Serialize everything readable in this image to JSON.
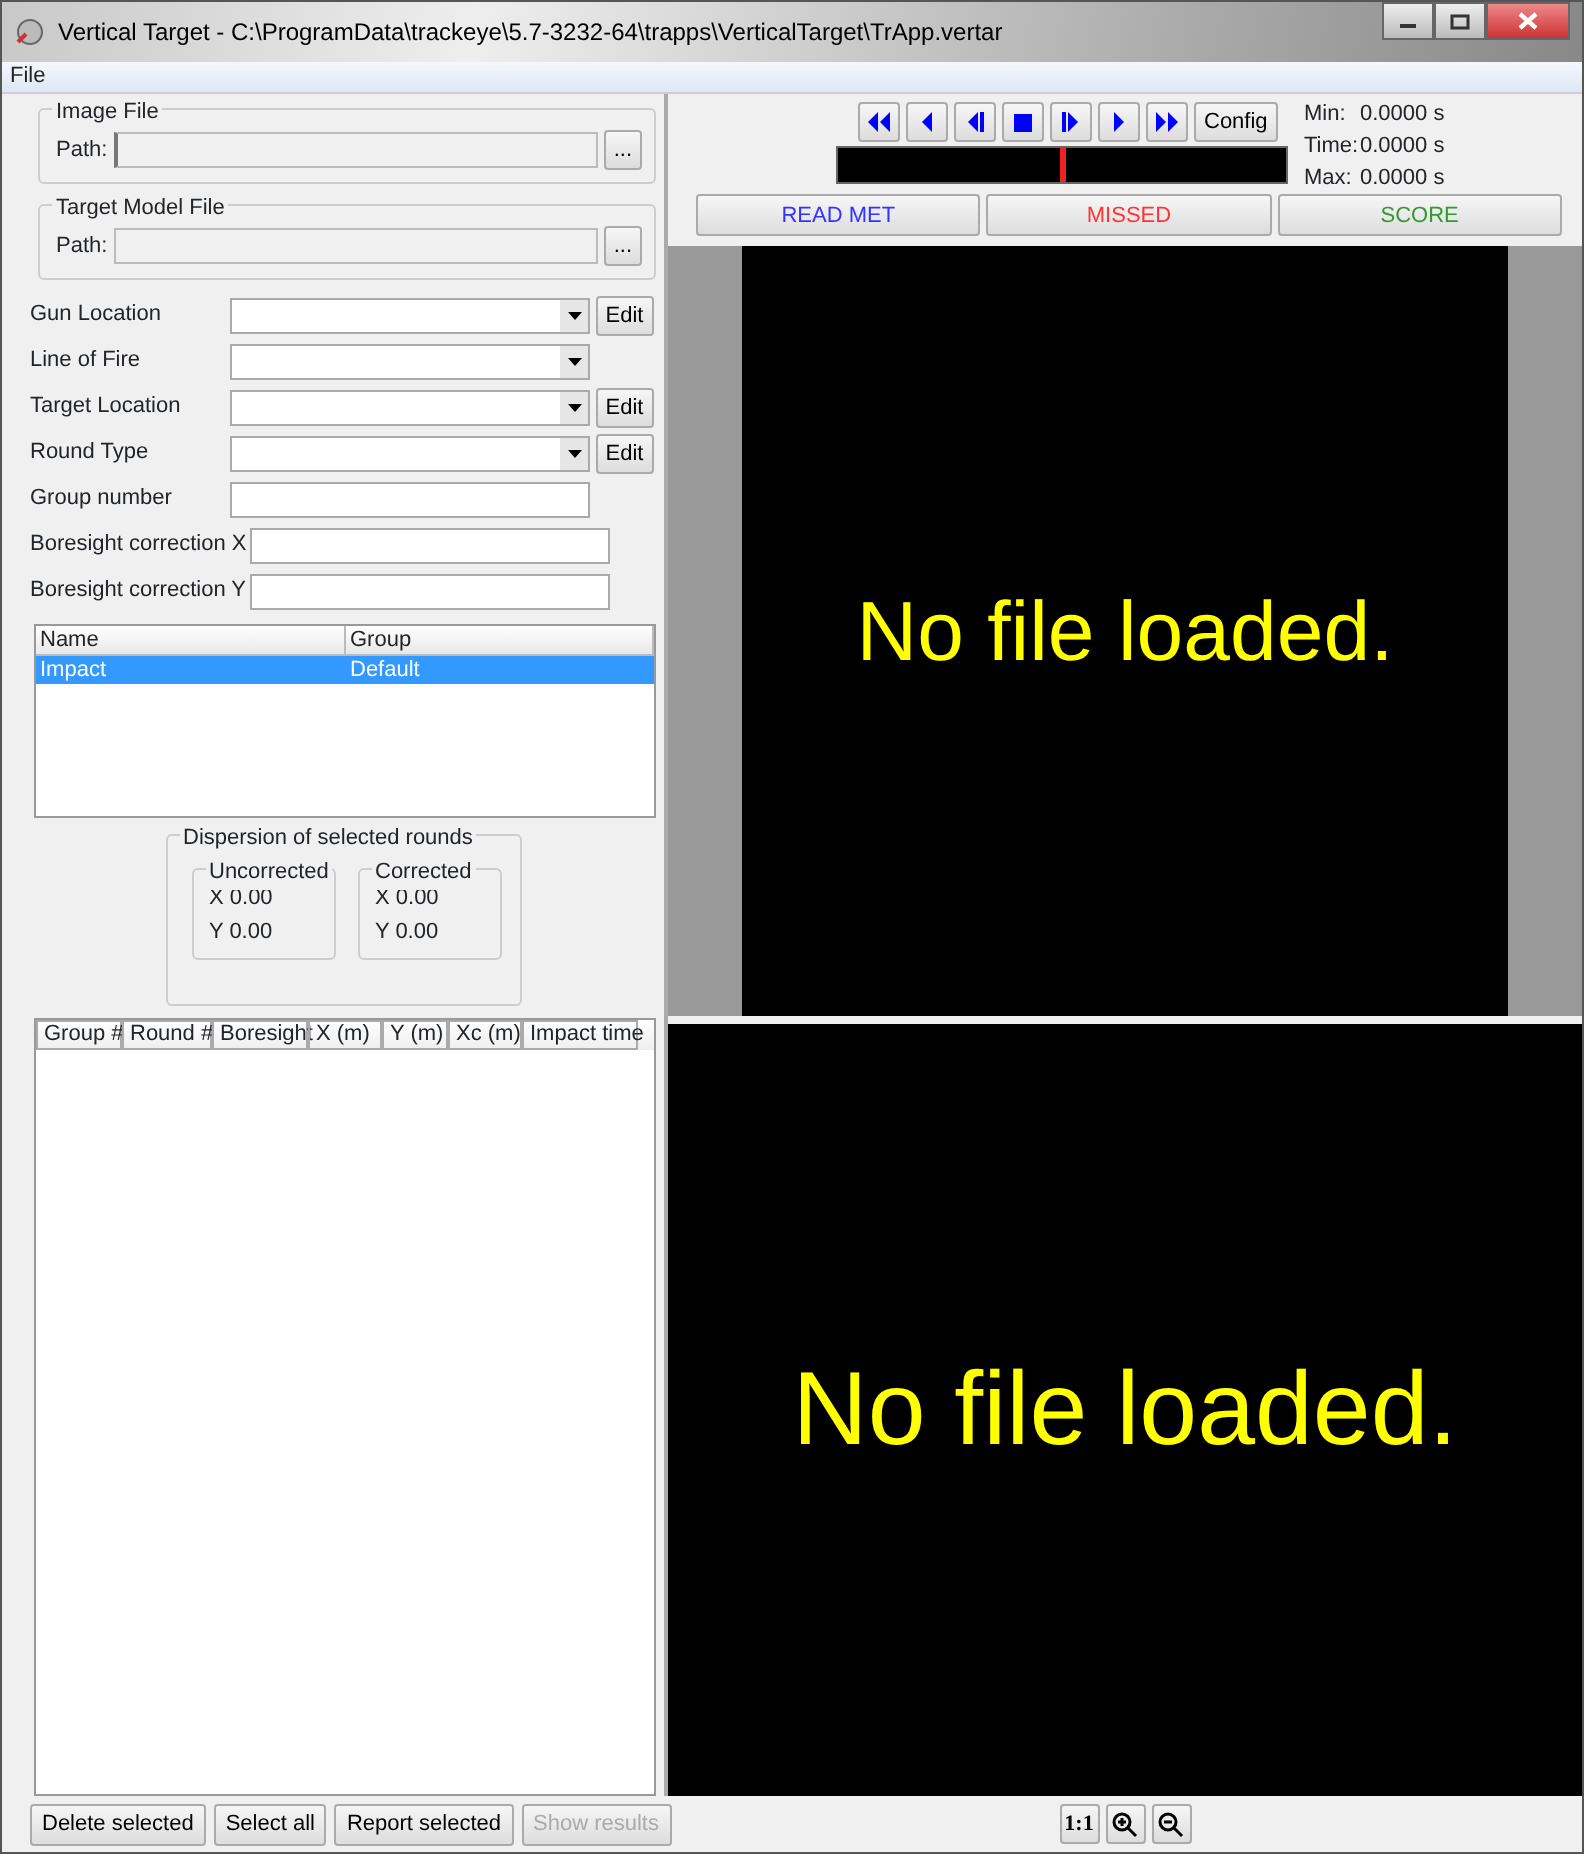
{
  "window": {
    "title": "Vertical Target - C:\\ProgramData\\trackeye\\5.7-3232-64\\trapps\\VerticalTarget\\TrApp.vertar"
  },
  "menu": [
    "File"
  ],
  "file_groups": [
    {
      "legend": "Image File",
      "label": "Path:",
      "button": "...",
      "caret": true
    },
    {
      "legend": "Target Model File",
      "label": "Path:",
      "button": "...",
      "caret": false
    }
  ],
  "form_rows": [
    {
      "label": "Gun Location",
      "kind": "combo",
      "button": "Edit"
    },
    {
      "label": "Line of Fire",
      "kind": "combo"
    },
    {
      "label": "Target Location",
      "kind": "combo",
      "button": "Edit"
    },
    {
      "label": "Round Type",
      "kind": "combo",
      "button": "Edit"
    },
    {
      "label": "Group number",
      "kind": "text"
    },
    {
      "label": "Boresight correction X",
      "kind": "text"
    },
    {
      "label": "Boresight correction Y",
      "kind": "text"
    }
  ],
  "impact_list": {
    "columns": [
      "Name",
      "Group"
    ],
    "rows": [
      {
        "cells": [
          "Impact",
          "Default"
        ],
        "selected": true
      }
    ]
  },
  "dispersion": {
    "legend": "Dispersion of selected rounds",
    "groups": [
      {
        "legend": "Uncorrected",
        "x": "X 0.00",
        "y": "Y 0.00"
      },
      {
        "legend": "Corrected",
        "x": "X 0.00",
        "y": "Y 0.00"
      }
    ]
  },
  "rounds_table": {
    "columns": [
      "Group #",
      "Round #",
      "Boresight",
      "X (m)",
      "Y (m)",
      "Xc (m)",
      "Impact time"
    ]
  },
  "transport": [
    {
      "kind": "first"
    },
    {
      "kind": "prev"
    },
    {
      "kind": "step-back"
    },
    {
      "kind": "stop"
    },
    {
      "kind": "step-forward"
    },
    {
      "kind": "next"
    },
    {
      "kind": "last"
    }
  ],
  "config_button": "Config",
  "timeline": {
    "level": 0.5
  },
  "times": [
    {
      "label": "Min:",
      "value": "0.0000 s"
    },
    {
      "label": "Time:",
      "value": "0.0000 s"
    },
    {
      "label": "Max:",
      "value": "0.0000 s"
    }
  ],
  "mode_buttons": [
    {
      "label": "READ MET",
      "color": "#3333ff"
    },
    {
      "label": "MISSED",
      "color": "#ff3333"
    },
    {
      "label": "SCORE",
      "color": "#339933"
    }
  ],
  "viewers": [
    {
      "message": "No file loaded."
    },
    {
      "message": "No file loaded."
    }
  ],
  "bottom_buttons": [
    {
      "label": "Delete selected",
      "disabled": false
    },
    {
      "label": "Select all",
      "disabled": false
    },
    {
      "label": "Report selected",
      "disabled": false
    },
    {
      "label": "Show results",
      "disabled": true
    }
  ],
  "zoom_buttons": [
    {
      "kind": "actual-size",
      "label": "1:1"
    },
    {
      "kind": "zoom-in"
    },
    {
      "kind": "zoom-out"
    }
  ]
}
